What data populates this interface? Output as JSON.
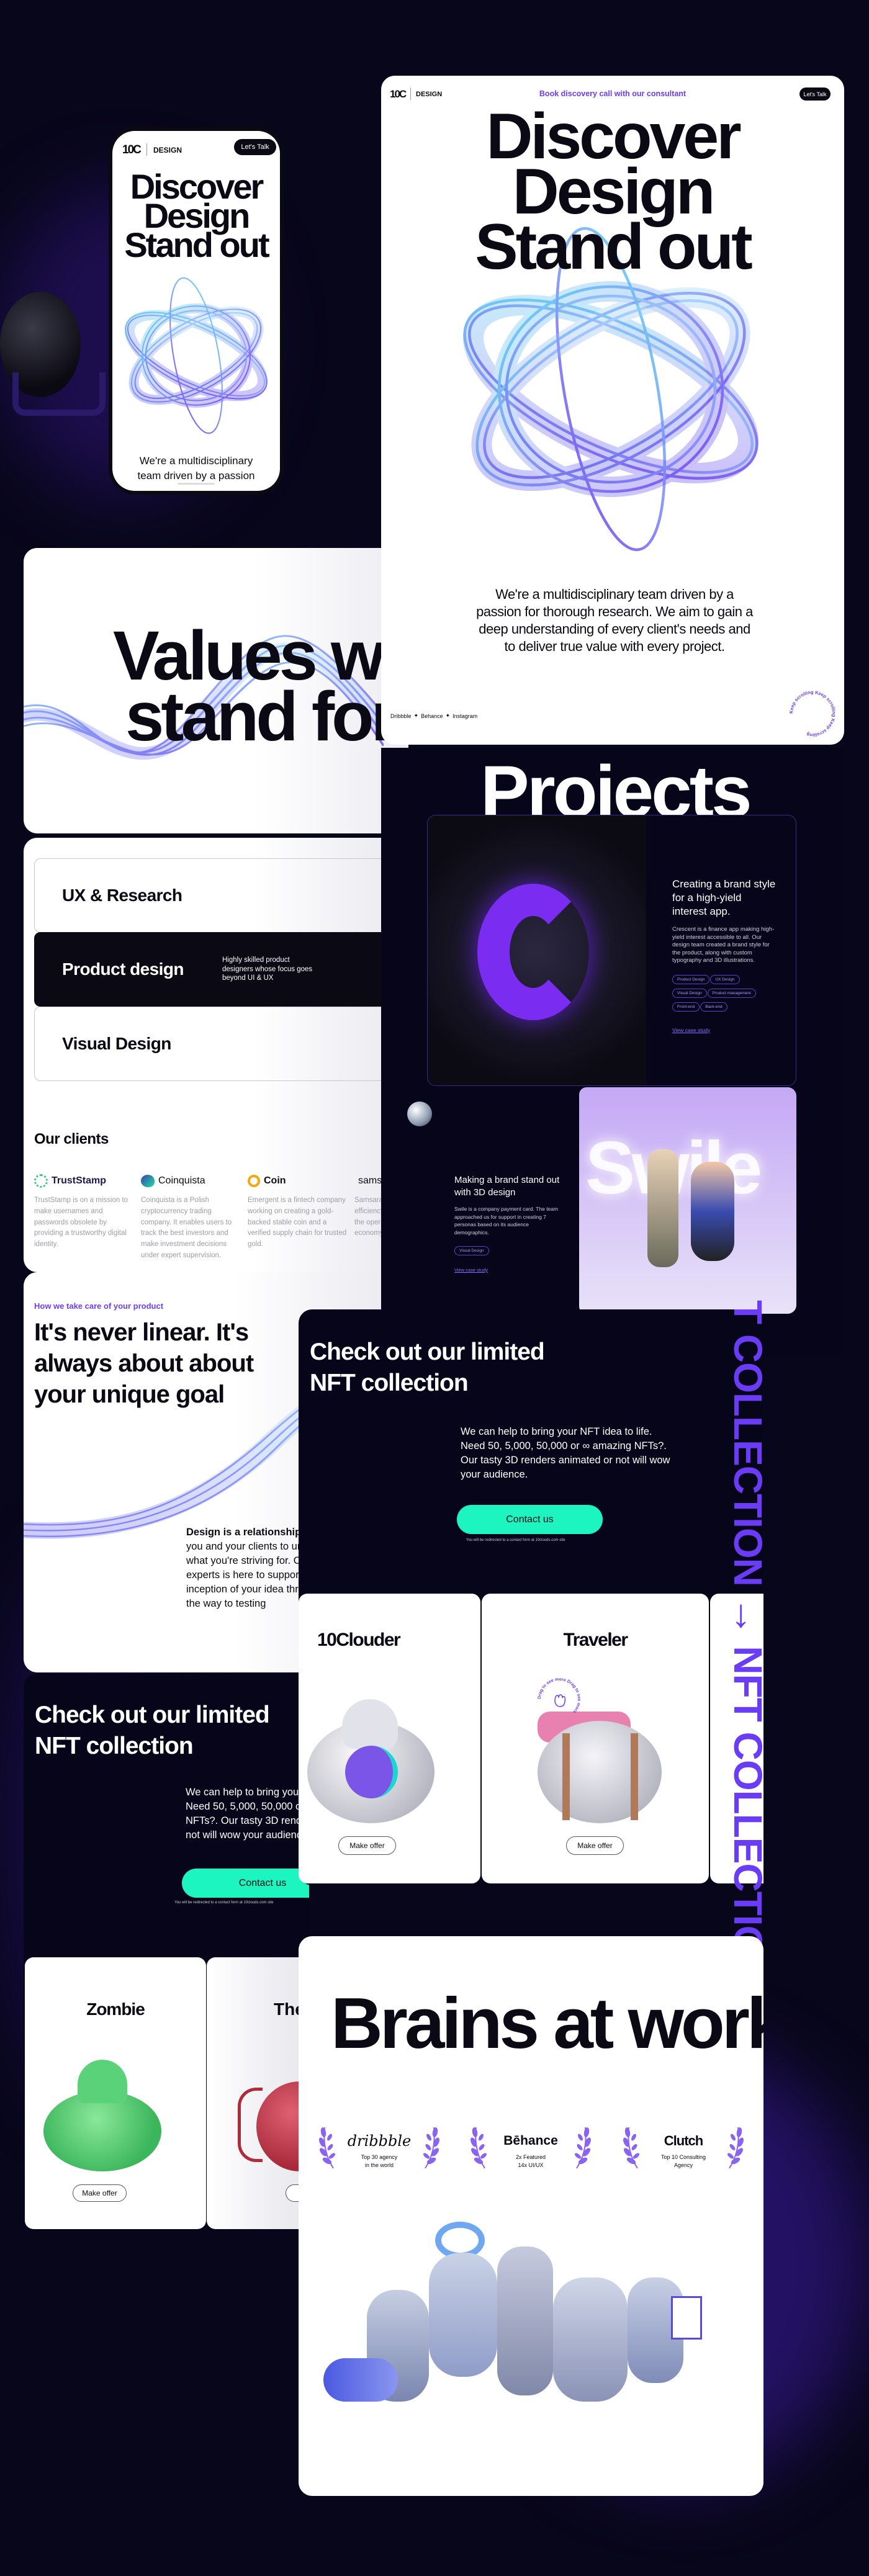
{
  "colors": {
    "background": "#08061a",
    "accent_purple": "#6b3cf5",
    "mint": "#1cf5c0",
    "dark_panel": "#06051a"
  },
  "phone": {
    "logo": "10C",
    "brand": "DESIGN",
    "cta": "Let's Talk",
    "headline": [
      "Discover",
      "Design",
      "Stand out"
    ],
    "intro": [
      "We're a multidisciplinary",
      "team driven by a passion"
    ]
  },
  "desktop": {
    "logo": "10C",
    "brand": "DESIGN",
    "nav_link": "Book discovery call with our consultant",
    "cta": "Let's Talk",
    "headline": [
      "Discover",
      "Design",
      "Stand out"
    ],
    "intro": "We're a multidisciplinary team driven by a passion for thorough research. We aim to gain a deep understanding of every client's needs and to deliver true value with every project.",
    "socials": [
      "Dribbble",
      "Behance",
      "Instagram"
    ],
    "scroll_badge": "Keep scrolling Keep scrolling Keep scrolling "
  },
  "values": {
    "headline": [
      "Values we",
      "stand for"
    ]
  },
  "services": [
    {
      "label": "UX & Research"
    },
    {
      "label": "Product design",
      "description": "Highly skilled product designers whose focus goes beyond UI & UX",
      "active": true
    },
    {
      "label": "Visual Design"
    }
  ],
  "clients": {
    "title": "Our clients",
    "items": [
      {
        "name": "TrustStamp",
        "description": "TrustStamp is on a mission to make usernames and passwords obsolete by providing a trustworthy digital identity."
      },
      {
        "name": "Coinquista",
        "description": "Coinquista is a Polish cryptocurrency trading company. It enables users to track the best investors and make investment decisions under expert supervision."
      },
      {
        "name": "Coin",
        "description": "Emergent is a fintech company working on creating a gold-backed stable coin and a verified supply chain for trusted gold."
      },
      {
        "name": "samsara",
        "description": "Samsara's efficiency, the operat economy."
      }
    ]
  },
  "process": {
    "eyebrow": "How we take care of your product",
    "headline": "It's never linear. It's always about about your unique goal",
    "body_bold": "Design is a relationship.",
    "body": " We get to know you and your clients to understand exactly what you're striving for. Our team of skilled experts is here to support you from the inception of your idea through delivery, all the way to testing"
  },
  "projects": {
    "title": "Projects",
    "items": [
      {
        "title": "Creating a brand style for a high-yield interest app.",
        "description": "Crescent is a finance app making high-yield interest accessible to all. Our design team created a brand style for the product, along with custom typography and 3D illustrations.",
        "tags": [
          "Product Design",
          "UX Design",
          "Visual Design",
          "Product management",
          "Front-end",
          "Back-end"
        ],
        "link": "View case study"
      },
      {
        "title": "Making a brand stand out with 3D design",
        "description": "Swile is a company payment card. The team approached us for support in creating 7 personas based on its audience demographics.",
        "tags": [
          "Visual Design"
        ],
        "link": "View case study",
        "image_text": "Swile"
      }
    ]
  },
  "nft": {
    "headline": "Check out our limited NFT collection",
    "body": "We can help to bring your NFT idea to life. Need 50, 5,000, 50,000 or ∞ amazing NFTs?. Our tasty 3D renders animated or not will wow your audience.",
    "cta": "Contact us",
    "note": "You will be redirected to a contact form at 10clouds.com site",
    "offer_label": "Make offer",
    "drag_hint": "Drag to see more Drag to see more ",
    "cards_center": [
      "10Clouder",
      "Traveler"
    ],
    "cards_left": [
      "Zombie",
      "The"
    ],
    "marquee": "T COLLECTION → NFT COLLECTION"
  },
  "brains": {
    "headline": "Brains at work",
    "awards": [
      {
        "logo": "dribbble",
        "line1": "Top 30 agency",
        "line2": "in the world"
      },
      {
        "logo": "Bēhance",
        "line1": "2x Featured",
        "line2": "14x UI/UX"
      },
      {
        "logo": "Clutch",
        "line1": "Top 10 Consulting",
        "line2": "Agency"
      }
    ]
  }
}
